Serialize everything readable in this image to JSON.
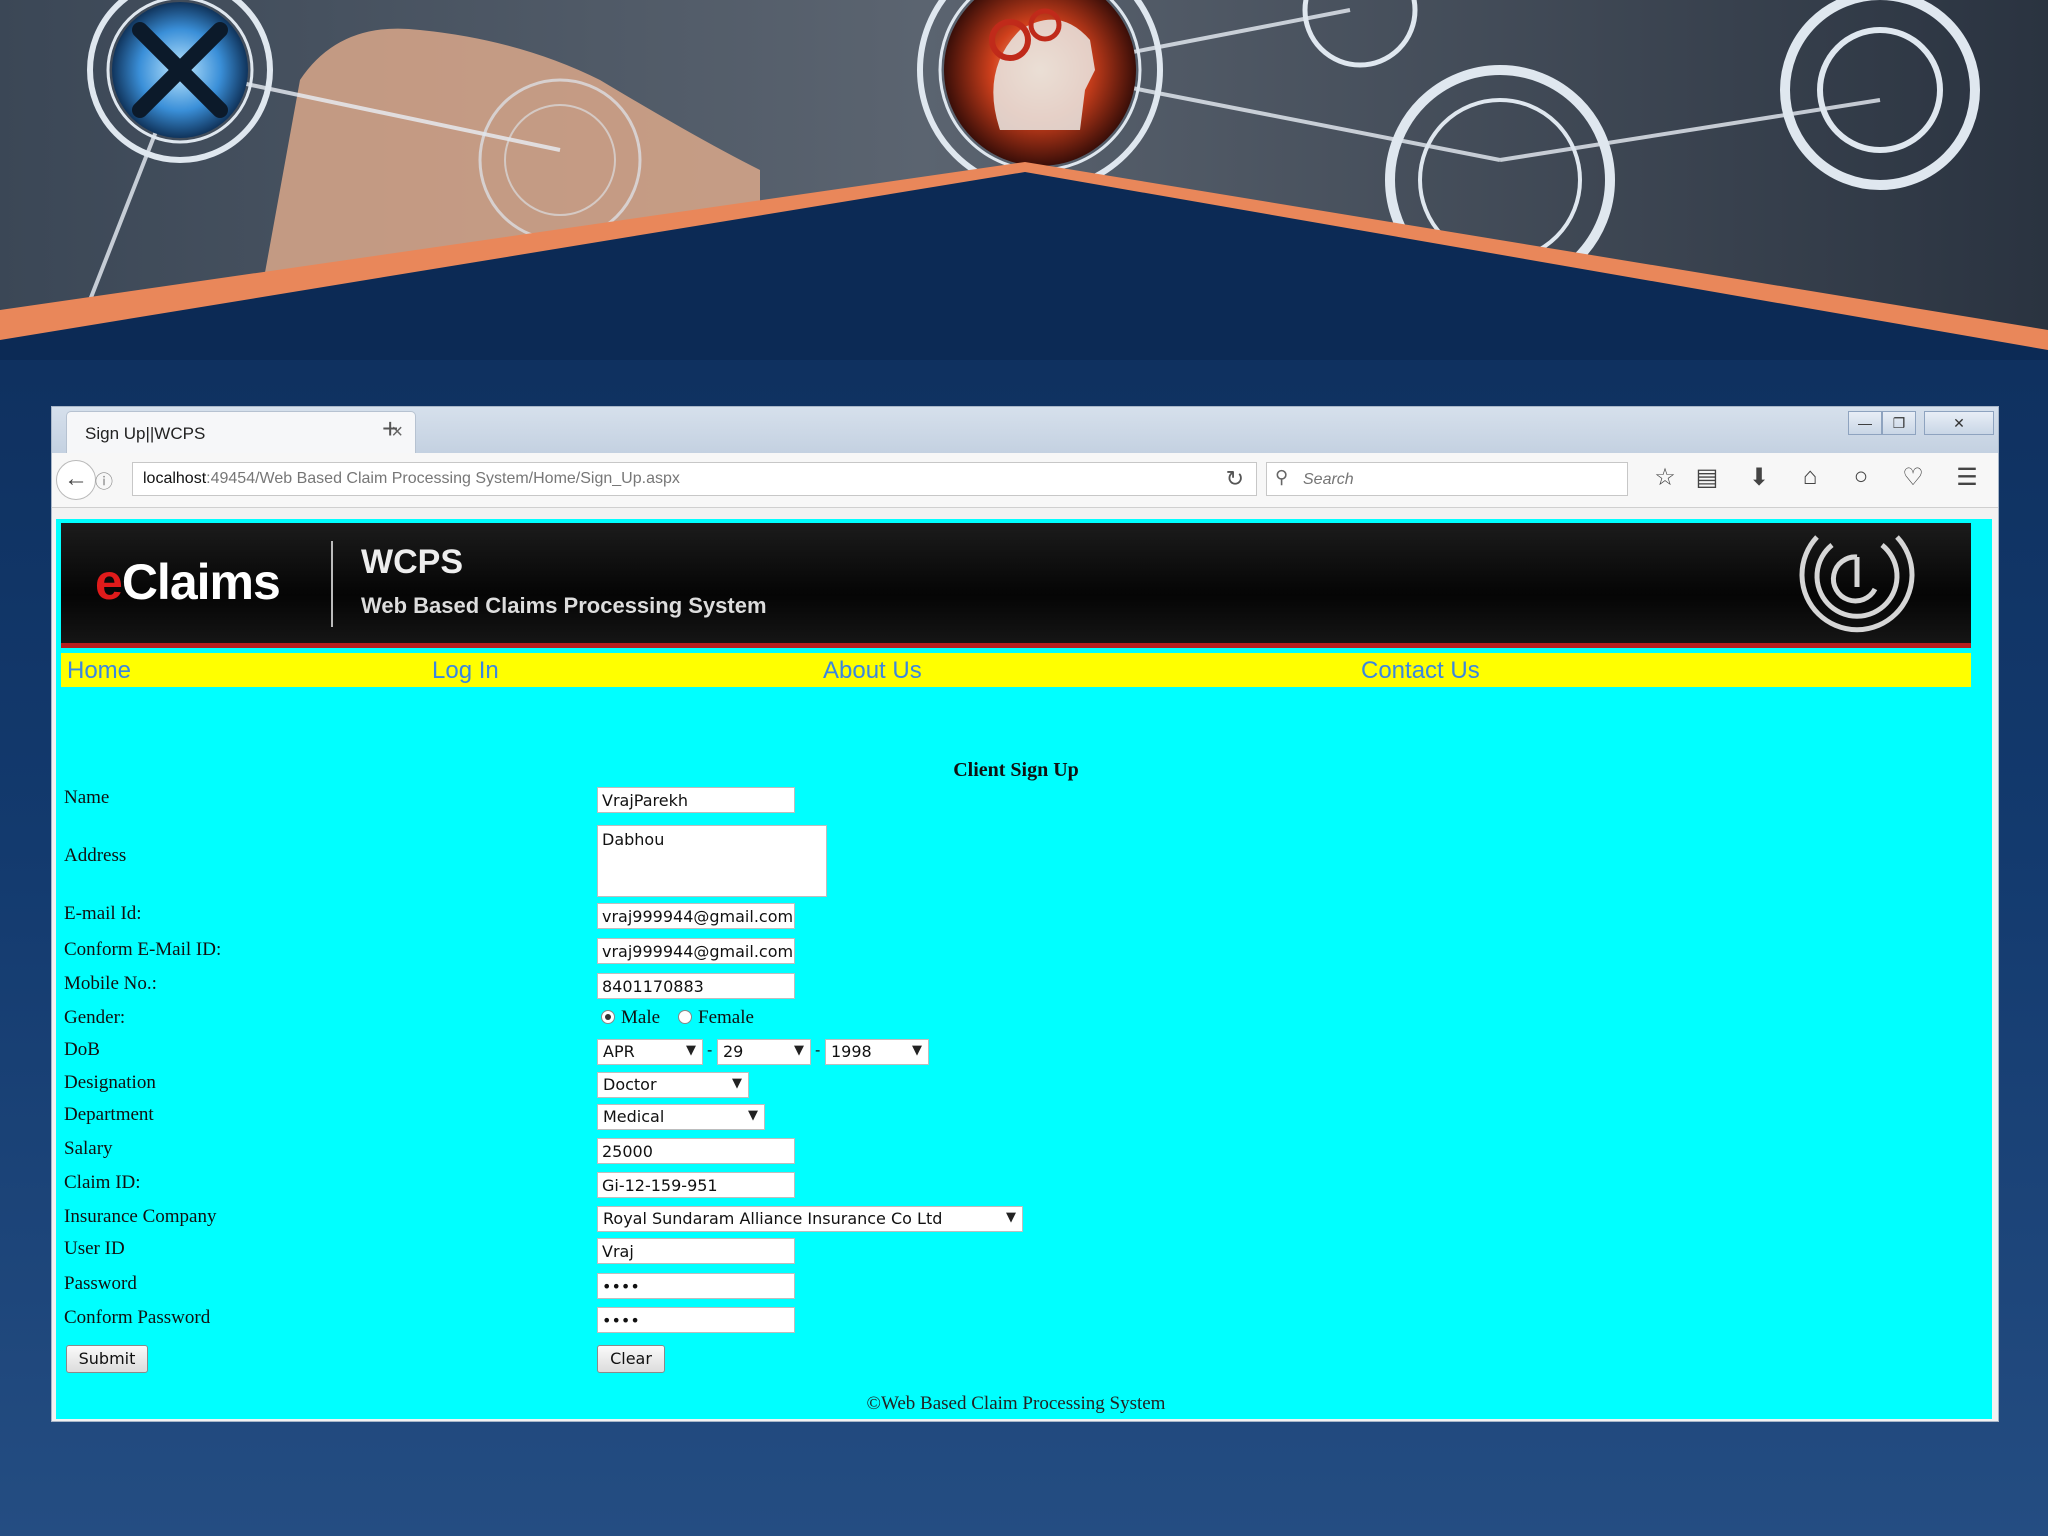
{
  "browser": {
    "tab_title": "Sign Up||WCPS",
    "url_host": "localhost",
    "url_path": ":49454/Web Based Claim Processing System/Home/Sign_Up.aspx",
    "search_placeholder": "Search"
  },
  "site": {
    "logo_e": "e",
    "logo_rest": "Claims",
    "abbr": "WCPS",
    "full_name": "Web Based Claims Processing System"
  },
  "menu": {
    "items": [
      {
        "label": "Home"
      },
      {
        "label": "Log In"
      },
      {
        "label": "About Us"
      },
      {
        "label": "Contact Us"
      }
    ]
  },
  "form": {
    "title": "Client Sign Up",
    "labels": {
      "name": "Name",
      "address": "Address",
      "email": "E-mail Id:",
      "confirm_email": "Conform E-Mail ID:",
      "mobile": "Mobile No.:",
      "gender": "Gender:",
      "dob": "DoB",
      "designation": "Designation",
      "department": "Department",
      "salary": "Salary",
      "claim_id": "Claim ID:",
      "insurance_company": "Insurance Company",
      "user_id": "User ID",
      "password": "Password",
      "confirm_password": "Conform Password"
    },
    "values": {
      "name": "VrajParekh",
      "address": "Dabhou",
      "email": "vraj999944@gmail.com",
      "confirm_email": "vraj999944@gmail.com",
      "mobile": "8401170883",
      "gender_options": [
        "Male",
        "Female"
      ],
      "gender_selected": "Male",
      "dob_month": "APR",
      "dob_day": "29",
      "dob_year": "1998",
      "dob_separator": "-",
      "designation": "Doctor",
      "department": "Medical",
      "salary": "25000",
      "claim_id": "Gi-12-159-951",
      "insurance_company": "Royal Sundaram Alliance Insurance Co Ltd",
      "user_id": "Vraj",
      "password": "••••",
      "confirm_password": "••••"
    },
    "buttons": {
      "submit": "Submit",
      "clear": "Clear"
    }
  },
  "footer": {
    "text": "©Web Based Claim Processing System"
  },
  "colors": {
    "page_bg": "#00ffff",
    "menu_bg": "#ffff00",
    "menu_link": "#3a86e0",
    "header_bg": "#0a0a0a",
    "header_accent": "#b51d1d",
    "slide_bg": "#133a6e",
    "slide_accent": "#e9875a"
  }
}
